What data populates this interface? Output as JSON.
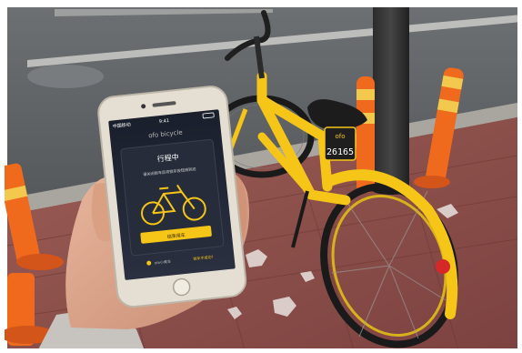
{
  "phone": {
    "status_carrier": "中国移动",
    "status_time": "9:41",
    "app_brand": "ofo bicycle",
    "card_title": "行程中",
    "card_message": "请关闭锁车后将锁车按钮滑到底",
    "action_button": "结束用车",
    "footer_text": "ofo小黄车",
    "footer_link": "锁车不成功?"
  },
  "bike": {
    "plate_number": "26165",
    "plate_header": "ofo"
  },
  "colors": {
    "bike_yellow": "#f5c518",
    "sidewalk_brick": "#8a4a45",
    "road_asphalt": "#5e6266",
    "bollard_orange": "#ef6a1c",
    "bollard_stripe": "#f2c94c",
    "phone_screen": "#202633",
    "phone_body": "#e5dfd3"
  }
}
